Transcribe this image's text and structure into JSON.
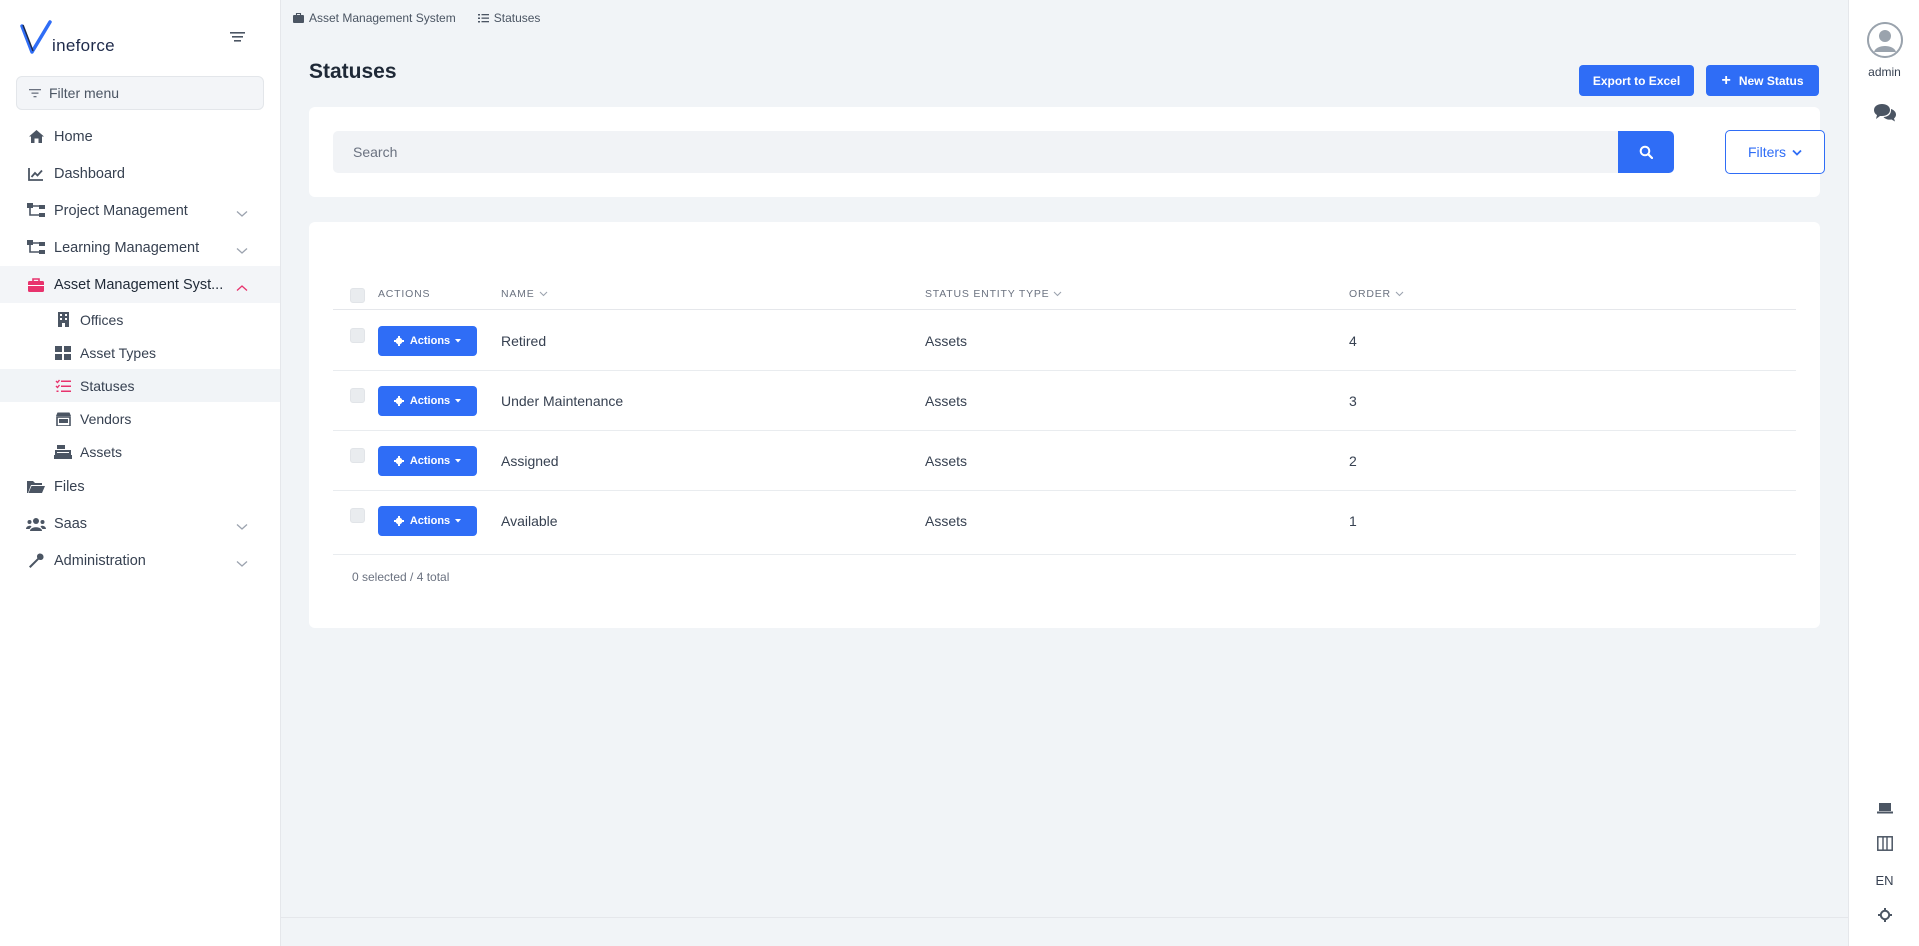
{
  "app": {
    "logo_text": "ineforce",
    "filter_menu_placeholder": "Filter menu"
  },
  "sidebar": {
    "items": [
      {
        "label": "Home",
        "icon": "home-icon"
      },
      {
        "label": "Dashboard",
        "icon": "chart-line-icon"
      },
      {
        "label": "Project Management",
        "icon": "sitemap-icon"
      },
      {
        "label": "Learning Management",
        "icon": "sitemap-icon"
      },
      {
        "label": "Asset Management Syst...",
        "icon": "briefcase-icon"
      },
      {
        "label": "Files",
        "icon": "folder-open-icon"
      },
      {
        "label": "Saas",
        "icon": "users-icon"
      },
      {
        "label": "Administration",
        "icon": "wrench-icon"
      }
    ],
    "sub_items": [
      {
        "label": "Offices",
        "icon": "building-icon"
      },
      {
        "label": "Asset Types",
        "icon": "grid-icon"
      },
      {
        "label": "Statuses",
        "icon": "list-check-icon"
      },
      {
        "label": "Vendors",
        "icon": "store-icon"
      },
      {
        "label": "Assets",
        "icon": "cash-register-icon"
      }
    ]
  },
  "breadcrumb": {
    "items": [
      "Asset Management System",
      "Statuses"
    ]
  },
  "page": {
    "title": "Statuses",
    "export_label": "Export to Excel",
    "new_label": "New Status"
  },
  "search": {
    "placeholder": "Search",
    "filters_label": "Filters"
  },
  "table": {
    "columns": [
      "ACTIONS",
      "NAME",
      "STATUS ENTITY TYPE",
      "ORDER"
    ],
    "action_label": "Actions",
    "rows": [
      {
        "name": "Retired",
        "entity_type": "Assets",
        "order": "4"
      },
      {
        "name": "Under Maintenance",
        "entity_type": "Assets",
        "order": "3"
      },
      {
        "name": "Assigned",
        "entity_type": "Assets",
        "order": "2"
      },
      {
        "name": "Available",
        "entity_type": "Assets",
        "order": "1"
      }
    ],
    "footer": "0 selected / 4 total"
  },
  "rail": {
    "user_label": "admin",
    "language": "EN"
  },
  "colors": {
    "primary": "#2f6df6",
    "active_accent": "#e8336d"
  }
}
